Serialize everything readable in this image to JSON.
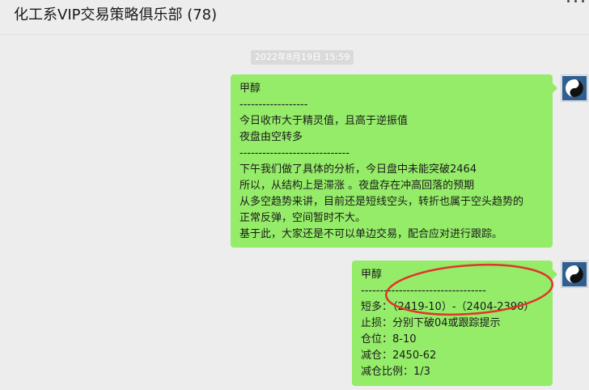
{
  "header": {
    "title": "化工系VIP交易策略俱乐部 (78)"
  },
  "timestamp": "2022年8月19日 15:59",
  "messages": [
    {
      "lines": [
        "甲醇",
        "------------------",
        "今日收市大于精灵值，且高于逆振值",
        "夜盘由空转多",
        "-----------------------------",
        "下午我们做了具体的分析，今日盘中未能突破2464",
        "所以，从结构上是滞涨 。夜盘存在冲高回落的预期",
        "从多空趋势来讲，目前还是短线空头，转折也属于空头趋势的",
        "正常反弹，空间暂时不大。",
        "基于此，大家还是不可以单边交易，配合应对进行跟踪。"
      ]
    },
    {
      "lines": [
        "甲醇",
        "---------------------------------",
        "短多：（2419-10）-（2404-2390）",
        "止损：分别下破04或跟踪提示",
        "仓位：8-10",
        "减仓：2450-62",
        "减仓比例：1/3"
      ]
    }
  ],
  "colors": {
    "bubble": "#95ec69",
    "annotation": "#e0352b",
    "background": "#ededed"
  }
}
